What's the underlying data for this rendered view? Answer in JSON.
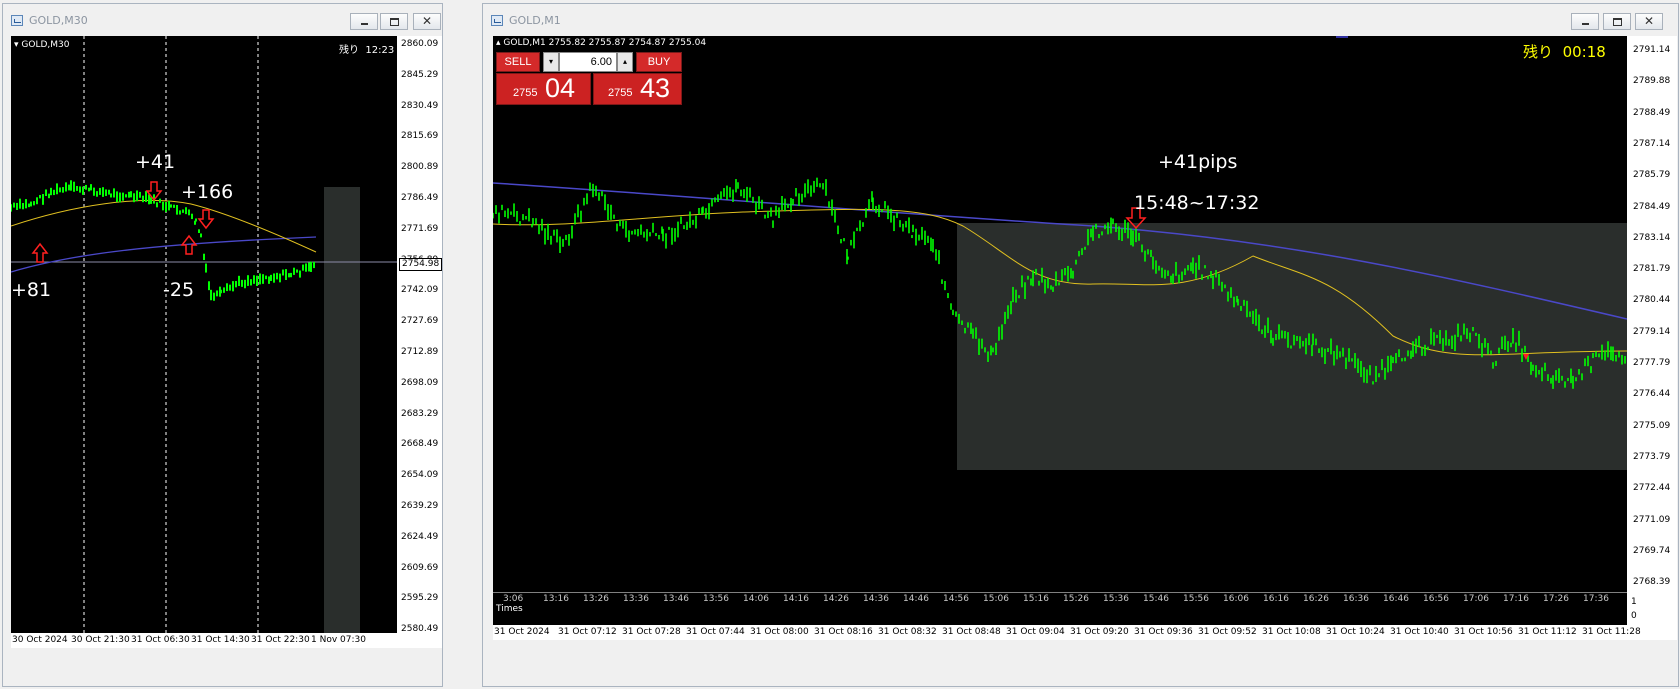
{
  "left_window": {
    "title": "GOLD,M30",
    "chart_label": "GOLD,M30",
    "countdown_label": "残り",
    "countdown": "12:23",
    "current_price": "2754.98",
    "annotations": [
      "+41",
      "+166",
      "+81",
      "-25"
    ],
    "price_axis": [
      "2860.09",
      "2845.29",
      "2830.49",
      "2815.69",
      "2800.89",
      "2786.49",
      "2771.69",
      "2756.89",
      "2742.09",
      "2727.69",
      "2712.89",
      "2698.09",
      "2683.29",
      "2668.49",
      "2654.09",
      "2639.29",
      "2624.49",
      "2609.69",
      "2595.29",
      "2580.49"
    ],
    "time_axis": [
      "30 Oct 2024",
      "30 Oct 21:30",
      "31 Oct 06:30",
      "31 Oct 14:30",
      "31 Oct 22:30",
      "1 Nov 07:30"
    ]
  },
  "right_window": {
    "title": "GOLD,M1",
    "chart_header": "GOLD,M1  2755.82 2755.87 2754.87 2755.04",
    "countdown_label": "残り",
    "countdown": "00:18",
    "annotation_pips": "+41pips",
    "annotation_time": "15:48~17:32",
    "trade_panel": {
      "sell_label": "SELL",
      "buy_label": "BUY",
      "lot": "6.00",
      "sell_prefix": "2755",
      "sell_price": "04",
      "buy_prefix": "2755",
      "buy_price": "43"
    },
    "price_axis": [
      "2791.14",
      "2789.88",
      "2788.49",
      "2787.14",
      "2785.79",
      "2784.49",
      "2783.14",
      "2781.79",
      "2780.44",
      "2779.14",
      "2777.79",
      "2776.44",
      "2775.09",
      "2773.79",
      "2772.44",
      "2771.09",
      "2769.74",
      "2768.39"
    ],
    "indicator_label": "Times",
    "indicator_axis": [
      "1",
      "0"
    ],
    "indicator_times": [
      "3:06",
      "13:16",
      "13:26",
      "13:36",
      "13:46",
      "13:56",
      "14:06",
      "14:16",
      "14:26",
      "14:36",
      "14:46",
      "14:56",
      "15:06",
      "15:16",
      "15:26",
      "15:36",
      "15:46",
      "15:56",
      "16:06",
      "16:16",
      "16:26",
      "16:36",
      "16:46",
      "16:56",
      "17:06",
      "17:16",
      "17:26",
      "17:36"
    ],
    "time_axis": [
      "31 Oct 2024",
      "31 Oct 07:12",
      "31 Oct 07:28",
      "31 Oct 07:44",
      "31 Oct 08:00",
      "31 Oct 08:16",
      "31 Oct 08:32",
      "31 Oct 08:48",
      "31 Oct 09:04",
      "31 Oct 09:20",
      "31 Oct 09:36",
      "31 Oct 09:52",
      "31 Oct 10:08",
      "31 Oct 10:24",
      "31 Oct 10:40",
      "31 Oct 10:56",
      "31 Oct 11:12",
      "31 Oct 11:28"
    ]
  },
  "colors": {
    "bull_candle": "#00ff00",
    "ma_fast": "#e0c020",
    "ma_slow": "#4a48c8",
    "arrow": "#ff2020",
    "zone": "#2a2e2c"
  }
}
